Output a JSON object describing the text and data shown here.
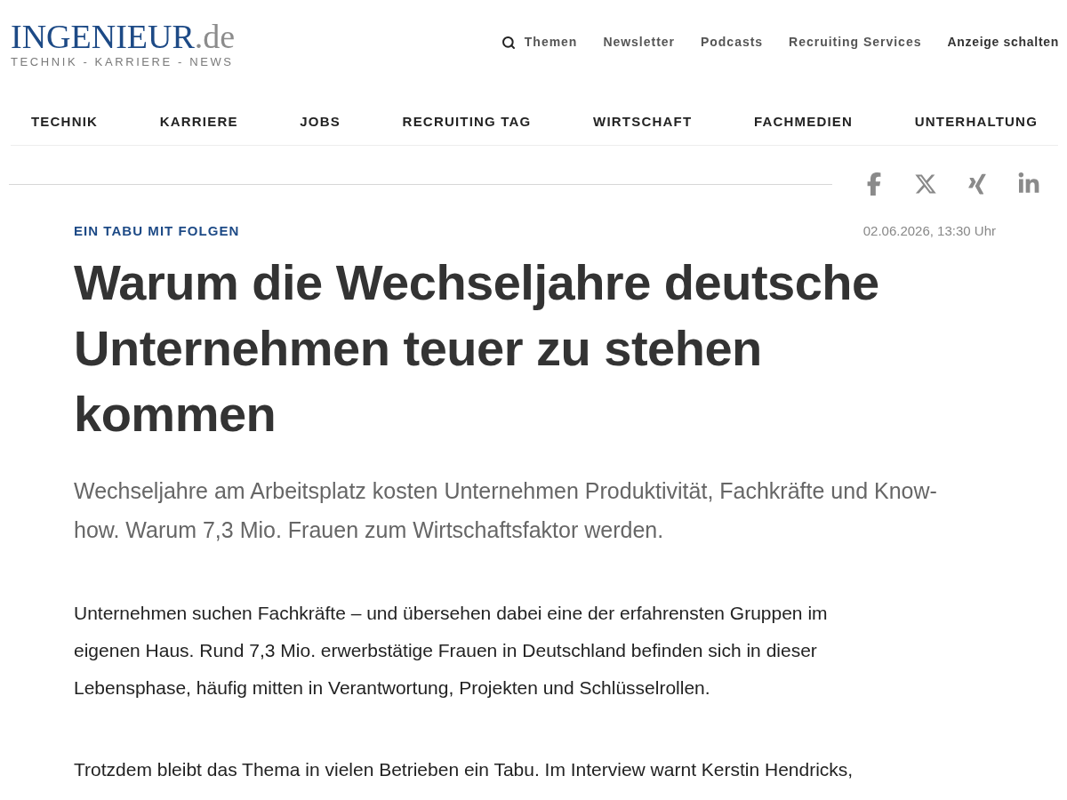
{
  "logo": {
    "name": "INGENIEUR",
    "suffix": ".de",
    "tagline": "TECHNIK - KARRIERE - NEWS"
  },
  "top_links": [
    {
      "label": "Themen",
      "kind": "search"
    },
    {
      "label": "Newsletter",
      "kind": "link"
    },
    {
      "label": "Podcasts",
      "kind": "link"
    },
    {
      "label": "Recruiting Services",
      "kind": "link"
    },
    {
      "label": "Anzeige schalten",
      "kind": "emphasis"
    }
  ],
  "main_nav": [
    {
      "label": "TECHNIK"
    },
    {
      "label": "KARRIERE"
    },
    {
      "label": "JOBS"
    },
    {
      "label": "RECRUITING TAG"
    },
    {
      "label": "WIRTSCHAFT"
    },
    {
      "label": "FACHMEDIEN"
    },
    {
      "label": "UNTERHALTUNG"
    }
  ],
  "article": {
    "kicker": "EIN TABU MIT FOLGEN",
    "date": "02.06.2026, 13:30 Uhr",
    "headline": "Warum die Wechseljahre deutsche Unternehmen teuer zu stehen kommen",
    "lead": "Wechseljahre am Arbeitsplatz kosten Unternehmen Produktivität, Fachkräfte und Know-how. Warum 7,3 Mio. Frauen zum Wirtschaftsfaktor werden.",
    "paragraphs": [
      "Unternehmen suchen Fachkräfte – und übersehen dabei eine der erfahrensten Gruppen im eigenen Haus. Rund 7,3 Mio. erwerbstätige Frauen in Deutschland befinden sich in dieser Lebensphase, häufig mitten in Verantwortung, Projekten und Schlüsselrollen.",
      "Trotzdem bleibt das Thema in vielen Betrieben ein Tabu. Im Interview warnt Kerstin Hendricks,"
    ]
  }
}
